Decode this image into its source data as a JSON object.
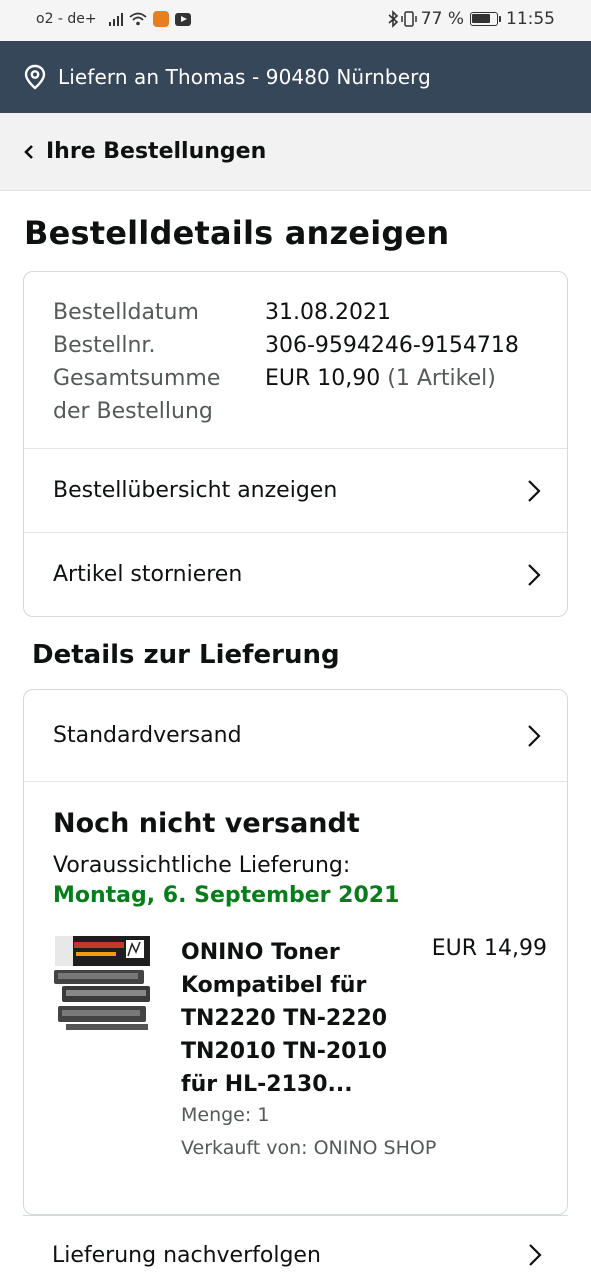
{
  "status_bar": {
    "carrier": "o2 - de+",
    "battery": "77 %",
    "time": "11:55",
    "icons": [
      "signal-icon",
      "wifi-icon",
      "burger-king-app-icon",
      "youtube-app-icon",
      "bluetooth-icon",
      "vibrate-icon",
      "battery-icon"
    ]
  },
  "delivery_bar": {
    "icon": "location-pin-icon",
    "text": "Liefern an Thomas - 90480 Nürnberg"
  },
  "back_nav": {
    "icon": "chevron-left-icon",
    "label": "Ihre Bestellungen"
  },
  "page_title": "Bestelldetails anzeigen",
  "order_info": {
    "rows": [
      {
        "key": "Bestelldatum",
        "value": "31.08.2021"
      },
      {
        "key": "Bestellnr.",
        "value": "306-9594246-9154718"
      },
      {
        "key": "Gesamtsumme der Bestellung",
        "key_line1": "Gesamtsumme",
        "key_line2": "der Bestellung",
        "value": "EUR 10,90",
        "value_extra": "(1 Artikel)"
      }
    ],
    "actions": [
      {
        "label": "Bestellübersicht anzeigen"
      },
      {
        "label": "Artikel stornieren"
      }
    ]
  },
  "delivery_section": {
    "title": "Details zur Lieferung",
    "shipping_method": "Standardversand",
    "status_title": "Noch nicht versandt",
    "eta_label": "Voraussichtliche Lieferung:",
    "eta_date": "Montag, 6. September 2021",
    "eta_color": "#067d1a",
    "product": {
      "title_lines": [
        "ONINO Toner",
        "Kompatibel für",
        "TN2220 TN-2220",
        "TN2010 TN-2010",
        "für HL-2130..."
      ],
      "price": "EUR 14,99",
      "quantity": "Menge: 1",
      "seller": "Verkauft von: ONINO SHOP"
    },
    "track_label": "Lieferung nachverfolgen"
  },
  "colors": {
    "header_bg": "#37475a",
    "nav_bg": "#f2f2f2",
    "border": "#d5d9d9",
    "muted_text": "#565959"
  }
}
